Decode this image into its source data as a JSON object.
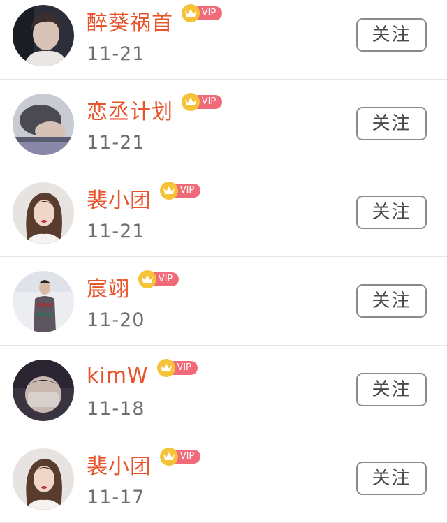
{
  "users": [
    {
      "name": "醉葵祸首",
      "vip": "VIP",
      "date": "11-21",
      "follow": "关注",
      "avatar": "male-portrait-1"
    },
    {
      "name": "恋丞计划",
      "vip": "VIP",
      "date": "11-21",
      "follow": "关注",
      "avatar": "sleeping-portrait"
    },
    {
      "name": "裴小团",
      "vip": "VIP",
      "date": "11-21",
      "follow": "关注",
      "avatar": "female-portrait"
    },
    {
      "name": "宸翊",
      "vip": "VIP",
      "date": "11-20",
      "follow": "关注",
      "avatar": "male-fullbody"
    },
    {
      "name": "kimW",
      "vip": "VIP",
      "date": "11-18",
      "follow": "关注",
      "avatar": "masked-portrait"
    },
    {
      "name": "裴小团",
      "vip": "VIP",
      "date": "11-17",
      "follow": "关注",
      "avatar": "female-portrait"
    }
  ],
  "colors": {
    "name": "#e8552d",
    "vip_pill": "#f06a78",
    "crown": "#f6c338",
    "date": "#6e6e6e",
    "button_border": "#8a8a8a"
  }
}
